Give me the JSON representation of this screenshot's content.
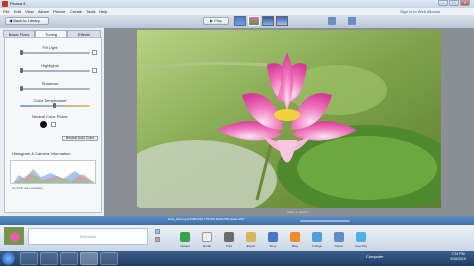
{
  "window": {
    "title": "Picasa 3",
    "close": "x"
  },
  "menu": [
    "File",
    "Edit",
    "View",
    "Album",
    "Picture",
    "Create",
    "Tools",
    "Help"
  ],
  "account": {
    "signin": "Sign in to Web Albums"
  },
  "toolbar": {
    "back_label": "Back to Library",
    "play_label": "Play"
  },
  "tabs": [
    "Basic Fixes",
    "Tuning",
    "Effects"
  ],
  "tuning": {
    "fill_light": "Fill Light",
    "highlights": "Highlights",
    "shadows": "Shadows",
    "color_temperature": "Color Temperature",
    "neutral_color_picker": "Neutral Color Picker",
    "neutral_button": "Neutral Auto Color"
  },
  "histogram": {
    "title": "Histogram & Camera Information",
    "note": "No EXIF data available"
  },
  "photo": {
    "caption": "Make a caption!"
  },
  "status": {
    "file": "lotus_flower.jpg  9/28/2010 7:56 PM  1024x768 pixels  25%"
  },
  "tray": {
    "placeholder": "Selection"
  },
  "actions": [
    "Upload",
    "Email",
    "Print",
    "Export",
    "Shop",
    "Blog",
    "Collage",
    "Movie",
    "Geo-Tag"
  ],
  "taskbar": {
    "computer": "Computer",
    "time": "7:24 PM",
    "date": "9/28/2010"
  },
  "colors": {
    "accent": "#3d6ea8",
    "close": "#c84a35",
    "taskbar": "#1f3c63"
  }
}
